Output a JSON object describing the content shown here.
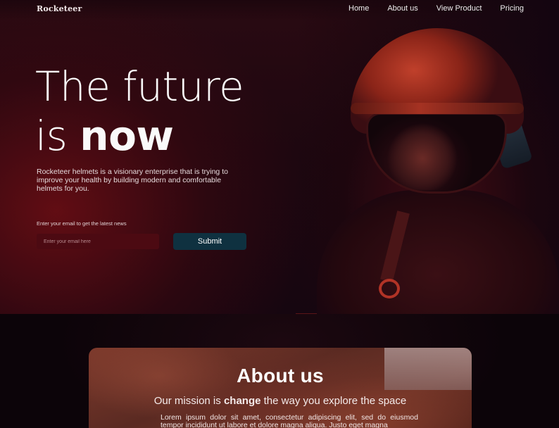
{
  "brand": "Rocketeer",
  "nav": {
    "items": [
      "Home",
      "About us",
      "View Product",
      "Pricing"
    ]
  },
  "hero": {
    "headline_line1": "The future",
    "headline_line2_prefix": "is ",
    "headline_line2_strong": "now",
    "lead": "Rocketeer helmets is a visionary enterprise that is trying to improve your health by building modern and comfortable helmets for you.",
    "email_label": "Enter your email to get the latest news",
    "email_placeholder": "Enter your email here",
    "submit_label": "Submit"
  },
  "about": {
    "title": "About us",
    "mission_prefix": "Our mission is ",
    "mission_strong": "change",
    "mission_suffix": " the way you explore the space",
    "text": "Lorem ipsum dolor sit amet, consectetur adipiscing elit, sed do eiusmod tempor incididunt ut labore et dolore magna aliqua. Justo eget magna"
  },
  "colors": {
    "input_bg": "#4c0a12",
    "button_bg": "#0f3140",
    "accent_red": "#b13326"
  },
  "icons": {
    "hero_image": "astronaut-helmet-photo",
    "about_image": "mars-rock-photo"
  }
}
